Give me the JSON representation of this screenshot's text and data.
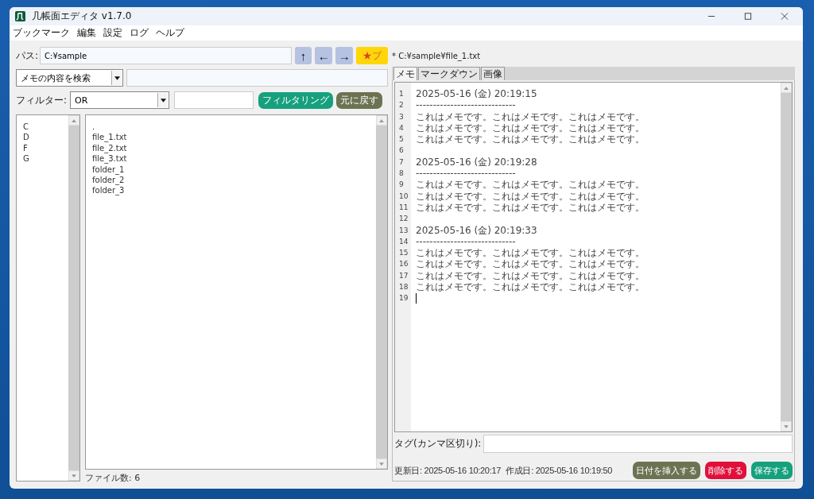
{
  "window": {
    "title": "几帳面エディタ v1.7.0"
  },
  "menu": [
    "ブックマーク",
    "編集",
    "設定",
    "ログ",
    "ヘルプ"
  ],
  "path": {
    "label": "パス:",
    "value": "C:¥sample"
  },
  "nav_buttons": [
    {
      "kind": "nav",
      "label": "↑"
    },
    {
      "kind": "nav",
      "label": "←"
    },
    {
      "kind": "nav",
      "label": "→"
    },
    {
      "kind": "bookmark",
      "label": "ブ",
      "star": "★"
    }
  ],
  "search": {
    "mode": "メモの内容を検索"
  },
  "filter": {
    "label": "フィルター:",
    "mode": "OR",
    "apply": "フィルタリング",
    "reset": "元に戻す"
  },
  "drives": [
    "C",
    "D",
    "F",
    "G"
  ],
  "files": [
    ".",
    "file_1.txt",
    "file_2.txt",
    "file_3.txt",
    "folder_1",
    "folder_2",
    "folder_3"
  ],
  "file_count": "ファイル数: 6",
  "current_file": "* C:¥sample¥file_1.txt",
  "tabs": [
    {
      "label": "メモ",
      "selected": true
    },
    {
      "label": "マークダウン",
      "selected": false
    },
    {
      "label": "画像",
      "selected": false
    }
  ],
  "editor": {
    "lines": [
      {
        "number": "1",
        "text": "2025-05-16 (金) 20:19:15"
      },
      {
        "number": "2",
        "text": "-----------------------------"
      },
      {
        "number": "3",
        "text": "これはメモです。これはメモです。これはメモです。"
      },
      {
        "number": "4",
        "text": "これはメモです。これはメモです。これはメモです。"
      },
      {
        "number": "5",
        "text": "これはメモです。これはメモです。これはメモです。"
      },
      {
        "number": "6"
      },
      {
        "number": "7",
        "text": "2025-05-16 (金) 20:19:28"
      },
      {
        "number": "8",
        "text": "-----------------------------"
      },
      {
        "number": "9",
        "text": "これはメモです。これはメモです。これはメモです。"
      },
      {
        "number": "10",
        "text": "これはメモです。これはメモです。これはメモです。"
      },
      {
        "number": "11",
        "text": "これはメモです。これはメモです。これはメモです。"
      },
      {
        "number": "12"
      },
      {
        "number": "13",
        "text": "2025-05-16 (金) 20:19:33"
      },
      {
        "number": "14",
        "text": "-----------------------------"
      },
      {
        "number": "15",
        "text": "これはメモです。これはメモです。これはメモです。"
      },
      {
        "number": "16",
        "text": "これはメモです。これはメモです。これはメモです。"
      },
      {
        "number": "17",
        "text": "これはメモです。これはメモです。これはメモです。"
      },
      {
        "number": "18",
        "text": "これはメモです。これはメモです。これはメモです。"
      },
      {
        "number": "19"
      }
    ]
  },
  "tags": {
    "label": "タグ(カンマ区切り):"
  },
  "status": {
    "updated": "更新日: 2025-05-16 10:20:17",
    "created": "作成日: 2025-05-16 10:19:50"
  },
  "actions": [
    {
      "kind": "insert",
      "label": "日付を挿入する"
    },
    {
      "kind": "delete",
      "label": "削除する"
    },
    {
      "kind": "save",
      "label": "保存する"
    }
  ]
}
